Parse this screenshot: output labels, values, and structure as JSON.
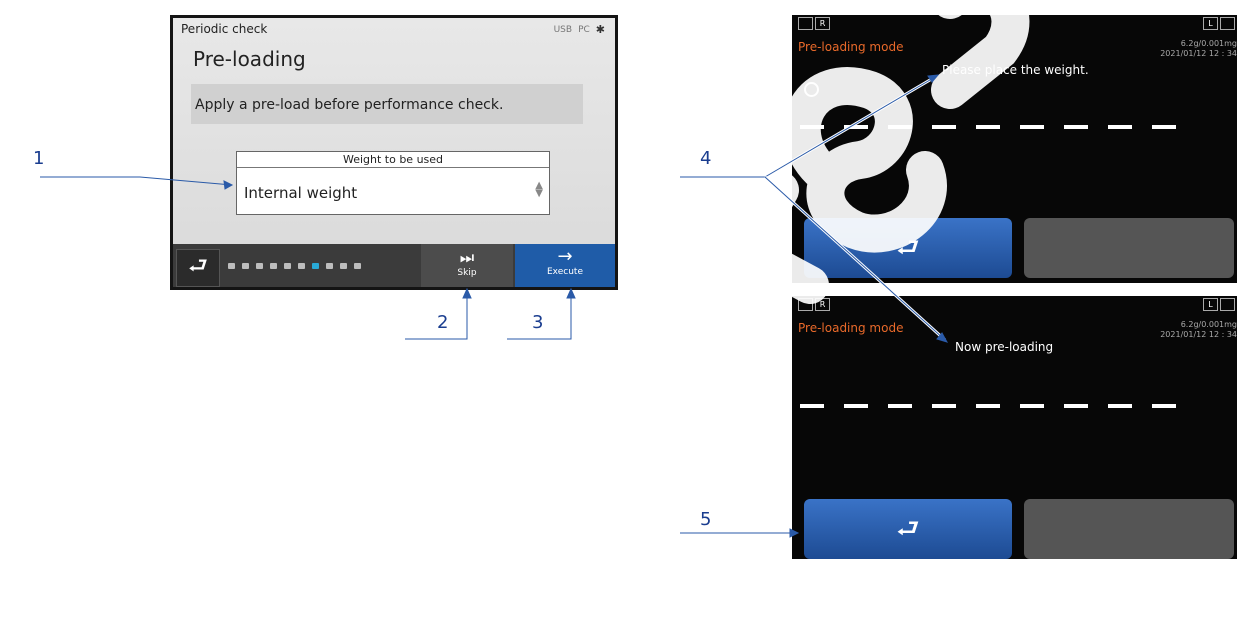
{
  "screen1": {
    "header": "Periodic check",
    "status": [
      "USB",
      "PC",
      "BT"
    ],
    "title": "Pre-loading",
    "message": "Apply a pre-load before performance check.",
    "weight_label": "Weight to be used",
    "weight_value": "Internal weight",
    "progress": {
      "total": 10,
      "current": 6
    },
    "skip_label": "Skip",
    "execute_label": "Execute"
  },
  "screen2": {
    "mode": "Pre-loading mode",
    "capacity": "6.2g/0.001mg",
    "datetime": "2021/01/12  12 : 34",
    "message": "Please place the weight.",
    "left_icon": "R",
    "right_icon": "L"
  },
  "screen3": {
    "mode": "Pre-loading mode",
    "capacity": "6.2g/0.001mg",
    "datetime": "2021/01/12  12 : 34",
    "message": "Now pre-loading",
    "left_icon": "R",
    "right_icon": "L"
  },
  "callouts": [
    "1",
    "2",
    "3",
    "4",
    "5"
  ],
  "colors": {
    "accent_blue": "#1f5ca8",
    "mode_orange": "#e8692a",
    "callout_blue": "#1a3d8f"
  }
}
